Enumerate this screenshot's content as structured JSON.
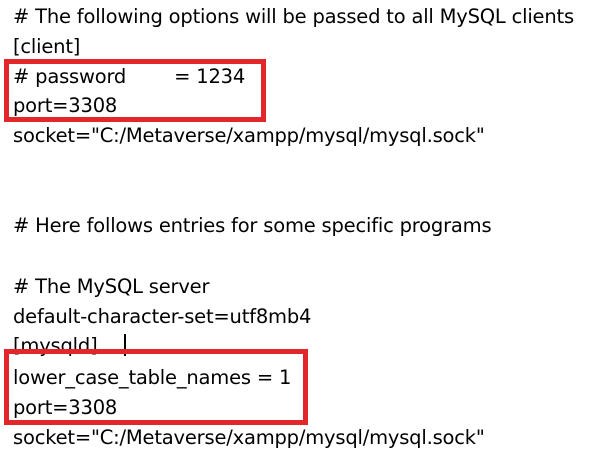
{
  "lines": [
    "# The following options will be passed to all MySQL clients",
    "[client]",
    "# password        = 1234",
    "port=3308",
    "socket=\"C:/Metaverse/xampp/mysql/mysql.sock\"",
    "",
    "",
    "# Here follows entries for some specific programs",
    "",
    "# The MySQL server",
    "default-character-set=utf8mb4",
    "[mysqld]",
    "lower_case_table_names = 1",
    "port=3308",
    "socket=\"C:/Metaverse/xampp/mysql/mysql.sock\""
  ],
  "highlight_color": "#e3262a"
}
